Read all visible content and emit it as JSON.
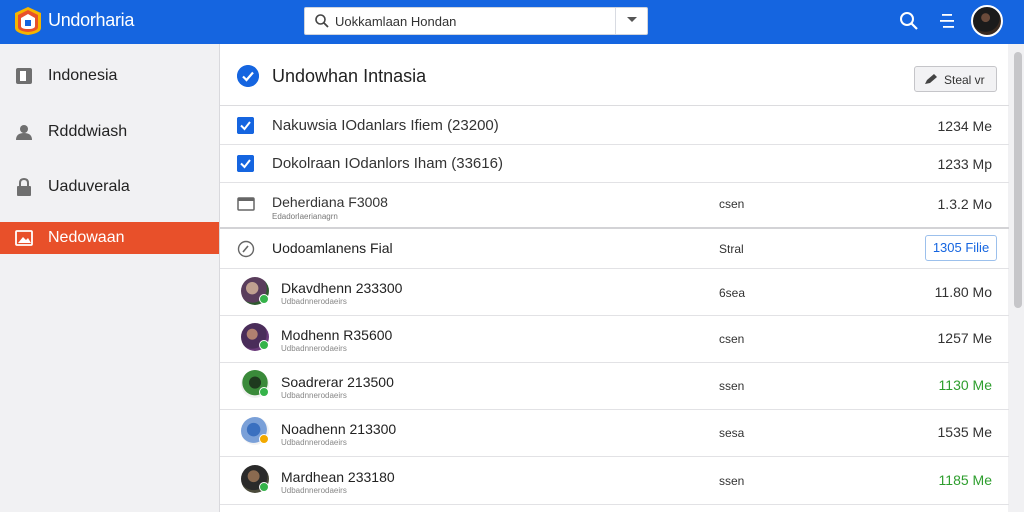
{
  "app": {
    "title": "Undorharia"
  },
  "search": {
    "value": "Uokkamlaan Hondan"
  },
  "colors": {
    "accent": "#1565e0",
    "active_nav": "#e8502a",
    "size_green": "#2e9e2e"
  },
  "sidebar": {
    "items": [
      {
        "label": "Indonesia",
        "icon": "document-icon",
        "active": false
      },
      {
        "label": "Rdddwiash",
        "icon": "person-icon",
        "active": false
      },
      {
        "label": "Uaduverala",
        "icon": "lock-icon",
        "active": false
      },
      {
        "label": "Nedowaan",
        "icon": "image-icon",
        "active": true
      }
    ]
  },
  "main": {
    "title": "Undowhan Intnasia",
    "action_label": "Steal vr"
  },
  "rows": [
    {
      "title": "Nakuwsia IOdanlars Ifiem (23200)",
      "size": "1234 Me",
      "checked": true
    },
    {
      "title": "Dokolraan IOdanlors Iham (33616)",
      "size": "1233 Mp",
      "checked": true
    },
    {
      "title": "Deherdiana F3008",
      "sub": "Edadorlaerianagrn",
      "status": "csen",
      "size": "1.3.2 Mo",
      "icon": "folder-icon"
    },
    {
      "title": "Uodoamlanens Fial",
      "status": "Stral",
      "file_button": "1305 Filie",
      "icon": "compass-icon"
    }
  ],
  "people": [
    {
      "name": "Dkavdhenn 233300",
      "sub": "Udbadnnerodaeirs",
      "status": "6sea",
      "size": "11.80 Mo",
      "size_green": false,
      "icon": "avatar-icon"
    },
    {
      "name": "Modhenn R35600",
      "sub": "Udbadnnerodaeirs",
      "status": "csen",
      "size": "1257 Me",
      "size_green": false,
      "icon": "avatar-icon"
    },
    {
      "name": "Soadrerar 213500",
      "sub": "Udbadnnerodaeirs",
      "status": "ssen",
      "size": "1130 Me",
      "size_green": true,
      "icon": "avatar-icon"
    },
    {
      "name": "Noadhenn 213300",
      "sub": "Udbadnnerodaeirs",
      "status": "sesa",
      "size": "1535 Me",
      "size_green": false,
      "icon": "avatar-icon"
    },
    {
      "name": "Mardhean 233180",
      "sub": "Udbadnnerodaeirs",
      "status": "ssen",
      "size": "1185 Me",
      "size_green": true,
      "icon": "avatar-icon"
    }
  ]
}
